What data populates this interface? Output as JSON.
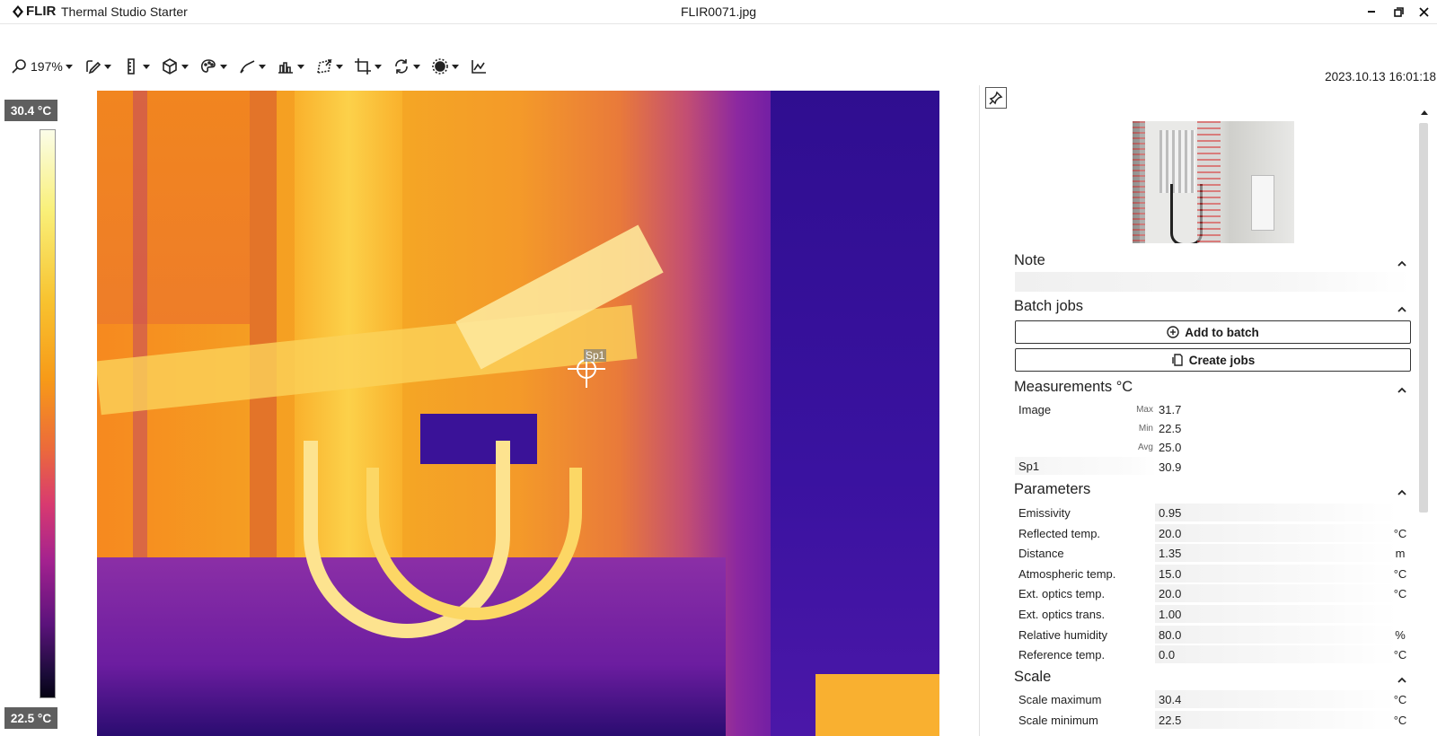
{
  "titlebar": {
    "brand": "FLIR",
    "app_name": "Thermal Studio Starter",
    "file_name": "FLIR0071.jpg"
  },
  "toolbar": {
    "zoom": "197%",
    "tools": [
      "edit-icon",
      "ruler-icon",
      "cube-icon",
      "palette-icon",
      "pen-icon",
      "histogram-icon",
      "transform-icon",
      "crop-icon",
      "rotate-icon",
      "exposure-icon",
      "trend-icon"
    ]
  },
  "timestamp": "2023.10.13 16:01:18",
  "color_scale": {
    "max_label": "30.4 °C",
    "min_label": "22.5 °C"
  },
  "spot": {
    "label": "Sp1"
  },
  "panel": {
    "note": {
      "title": "Note"
    },
    "batch": {
      "title": "Batch jobs",
      "add_label": "Add to batch",
      "create_label": "Create jobs"
    },
    "measurements": {
      "title": "Measurements °C",
      "image_label": "Image",
      "stats": [
        {
          "key": "Max",
          "value": "31.7"
        },
        {
          "key": "Min",
          "value": "22.5"
        },
        {
          "key": "Avg",
          "value": "25.0"
        }
      ],
      "sp1_label": "Sp1",
      "sp1_value": "30.9"
    },
    "parameters": {
      "title": "Parameters",
      "rows": [
        {
          "label": "Emissivity",
          "value": "0.95",
          "unit": ""
        },
        {
          "label": "Reflected temp.",
          "value": "20.0",
          "unit": "°C"
        },
        {
          "label": "Distance",
          "value": "1.35",
          "unit": "m"
        },
        {
          "label": "Atmospheric temp.",
          "value": "15.0",
          "unit": "°C"
        },
        {
          "label": "Ext. optics temp.",
          "value": "20.0",
          "unit": "°C"
        },
        {
          "label": "Ext. optics trans.",
          "value": "1.00",
          "unit": ""
        },
        {
          "label": "Relative humidity",
          "value": "80.0",
          "unit": "%"
        },
        {
          "label": "Reference temp.",
          "value": "0.0",
          "unit": "°C"
        }
      ]
    },
    "scale": {
      "title": "Scale",
      "rows": [
        {
          "label": "Scale maximum",
          "value": "30.4",
          "unit": "°C"
        },
        {
          "label": "Scale minimum",
          "value": "22.5",
          "unit": "°C"
        }
      ]
    }
  },
  "colors": {
    "scale_label_bg": "#5f5f5f",
    "accent": "#222222"
  }
}
